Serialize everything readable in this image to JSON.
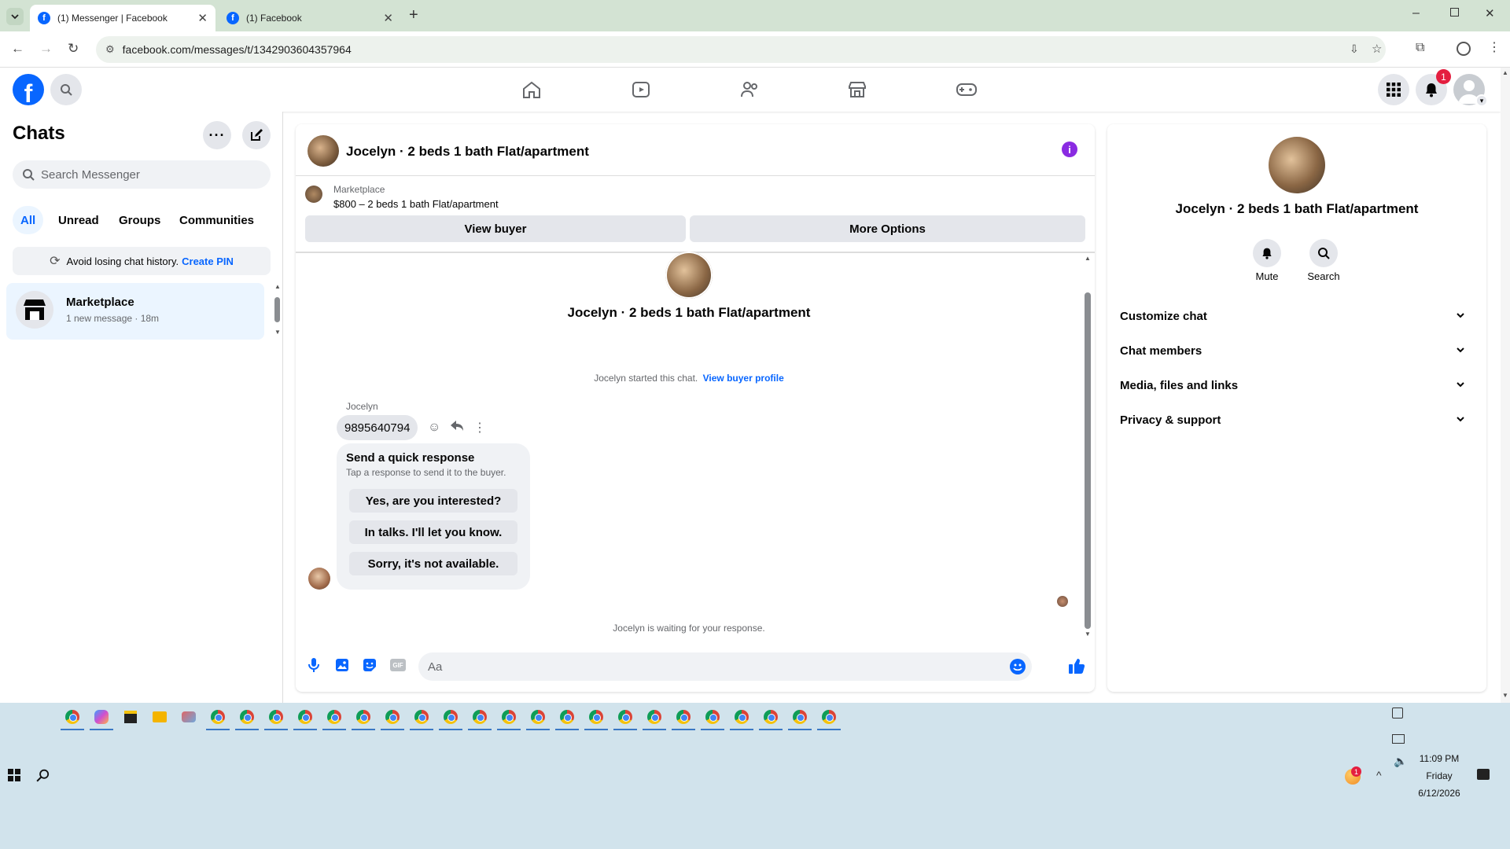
{
  "browser": {
    "tabs": [
      {
        "title": "(1) Messenger | Facebook",
        "active": true
      },
      {
        "title": "(1) Facebook",
        "active": false
      }
    ],
    "url": "facebook.com/messages/t/1342903604357964"
  },
  "fb_header": {
    "notification_badge": "1",
    "nav_icons": [
      "home-icon",
      "video-icon",
      "friends-icon",
      "marketplace-icon",
      "gaming-icon"
    ]
  },
  "sidebar": {
    "title": "Chats",
    "search_placeholder": "Search Messenger",
    "filters": [
      "All",
      "Unread",
      "Groups",
      "Communities"
    ],
    "active_filter": "All",
    "pin_notice": {
      "text": "Avoid losing chat history.",
      "link": "Create PIN"
    },
    "chats": [
      {
        "name": "Marketplace",
        "preview": "1 new message · 18m"
      }
    ]
  },
  "conversation": {
    "title": "Jocelyn · 2 beds 1 bath Flat/apartment",
    "listing": {
      "source": "Marketplace",
      "summary": "$800 – 2 beds 1 bath Flat/apartment"
    },
    "view_buyer_label": "View buyer",
    "more_options_label": "More Options",
    "intro_name": "Jocelyn · 2 beds 1 bath Flat/apartment",
    "started_text": "Jocelyn started this chat.",
    "view_profile_link": "View buyer profile",
    "sender": "Jocelyn",
    "message": "9895640794",
    "quick_response": {
      "title": "Send a quick response",
      "subtitle": "Tap a response to send it to the buyer.",
      "options": [
        "Yes, are you interested?",
        "In talks. I'll let you know.",
        "Sorry, it's not available."
      ]
    },
    "waiting_text": "Jocelyn is waiting for your response.",
    "composer_placeholder": "Aa",
    "accent_color": "#0866ff"
  },
  "details": {
    "name": "Jocelyn · 2 beds 1 bath Flat/apartment",
    "actions": [
      "Mute",
      "Search"
    ],
    "sections": [
      "Customize chat",
      "Chat members",
      "Media, files and links",
      "Privacy & support"
    ]
  },
  "taskbar": {
    "time": "11:09 PM",
    "day": "Friday",
    "date": "6/12/2026",
    "tray_badge": "1"
  }
}
